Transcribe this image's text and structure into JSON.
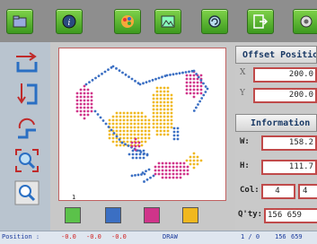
{
  "canvas": {
    "number": "1"
  },
  "swatches": [
    "#5bc24a",
    "#3b6fc3",
    "#d0348a",
    "#f0b81f"
  ],
  "offset": {
    "title": "Offset Position",
    "x_label": "X",
    "x_value": "200.0",
    "y_label": "Y",
    "y_value": "200.0"
  },
  "info": {
    "title": "Information",
    "w_label": "W:",
    "w_value": "158.2",
    "h_label": "H:",
    "h_value": "111.7",
    "col_label": "Col:",
    "col_value": "4",
    "col_value2": "4",
    "qty_label": "Q'ty:",
    "qty_value": "156 659"
  },
  "status": {
    "position_label": "Position :",
    "v1": "-0.0",
    "v2": "-0.0",
    "v3": "-0.0",
    "mode": "DRAW",
    "page": "1 / 0",
    "n1": "156",
    "n2": "659"
  },
  "colors": {
    "accent_red": "#c04a4a",
    "panel_title": "#1a3a66",
    "status_red": "#d02020"
  }
}
